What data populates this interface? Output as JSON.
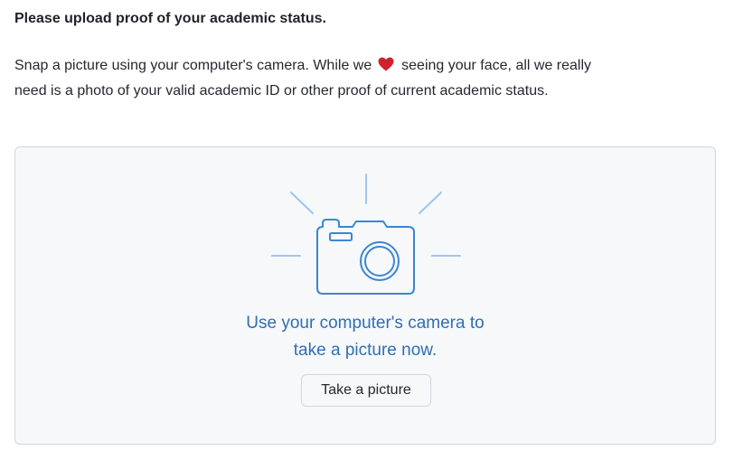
{
  "heading": "Please upload proof of your academic status.",
  "intro": {
    "before_heart": "Snap a picture using your computer's camera. While we",
    "after_heart": "seeing your face, all we really need is a photo of your valid academic ID or other proof of current academic status."
  },
  "upload": {
    "prompt_line1": "Use your computer's camera to",
    "prompt_line2": "take a picture now.",
    "button_label": "Take a picture"
  },
  "icons": {
    "heart": "heart-icon",
    "camera": "camera-icon"
  },
  "colors": {
    "heart": "#cf222e",
    "accent": "#2f6fb5",
    "camera_outline": "#3a86d4",
    "camera_rays": "#9cc7ee"
  }
}
